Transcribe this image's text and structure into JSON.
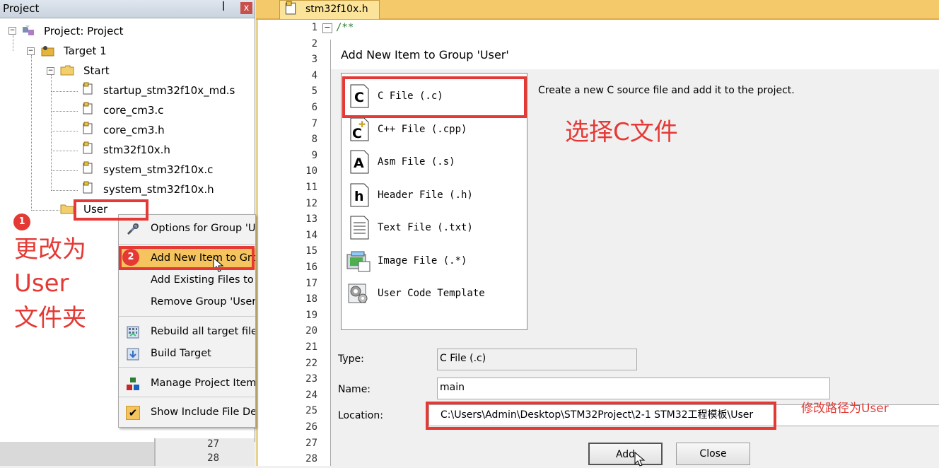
{
  "project_panel": {
    "title": "Project",
    "pin_glyph": "ꟾ",
    "close_glyph": "x",
    "tree": {
      "root": "Project: Project",
      "target": "Target 1",
      "start_group": "Start",
      "files": [
        "startup_stm32f10x_md.s",
        "core_cm3.c",
        "core_cm3.h",
        "stm32f10x.h",
        "system_stm32f10x.c",
        "system_stm32f10x.h"
      ],
      "user_group": "User"
    }
  },
  "context_menu": {
    "items": [
      {
        "label": "Options for Group 'User'",
        "icon": "options-icon"
      },
      {
        "label": "Add New  Item to Group 'User'",
        "icon": "none"
      },
      {
        "label": "Add Existing Files to Group 'User'",
        "icon": "none"
      },
      {
        "label": "Remove Group 'User'",
        "icon": "none"
      },
      {
        "label": "Rebuild all target files",
        "icon": "rebuild-icon"
      },
      {
        "label": "Build Target",
        "icon": "build-icon"
      },
      {
        "label": "Manage Project Items",
        "icon": "manage-icon"
      },
      {
        "label": "Show Include File Dependencies",
        "icon": "checkmark-icon"
      }
    ],
    "highlight_color": "#f5c45e"
  },
  "editor": {
    "tab_label": "stm32f10x.h",
    "first_line_text": "/**",
    "line_numbers": [
      "1",
      "2",
      "3",
      "4",
      "5",
      "6",
      "7",
      "8",
      "9",
      "10",
      "11",
      "12",
      "13",
      "14",
      "15",
      "16",
      "17",
      "18",
      "19",
      "20",
      "21",
      "22",
      "23",
      "24",
      "25",
      "26",
      "27",
      "28"
    ],
    "bottom_line_numbers": [
      "27",
      "28"
    ]
  },
  "dialog": {
    "title": "Add New Item to Group 'User'",
    "description": "Create a new C source file and add it to the project.",
    "items": [
      {
        "label": "C File (.c)",
        "icon_glyph": "C"
      },
      {
        "label": "C++ File (.cpp)",
        "icon_glyph": "C"
      },
      {
        "label": "Asm File (.s)",
        "icon_glyph": "A"
      },
      {
        "label": "Header File (.h)",
        "icon_glyph": "h"
      },
      {
        "label": "Text File (.txt)",
        "icon_glyph": ""
      },
      {
        "label": "Image File (.*)",
        "icon_glyph": ""
      },
      {
        "label": "User Code Template",
        "icon_glyph": ""
      }
    ],
    "type_label": "Type:",
    "type_value": "C File (.c)",
    "name_label": "Name:",
    "name_value": "main",
    "location_label": "Location:",
    "location_value": "C:\\Users\\Admin\\Desktop\\STM32Project\\2-1 STM32工程模板\\User",
    "add_button": "Add",
    "close_button": "Close"
  },
  "annotations": {
    "badge_1": "1",
    "badge_2": "2",
    "note_rename_line1": "更改为",
    "note_rename_line2": "User",
    "note_rename_line3": "文件夹",
    "note_select_c": "选择C文件",
    "note_location": "修改路径为User",
    "color": "#e53935"
  }
}
